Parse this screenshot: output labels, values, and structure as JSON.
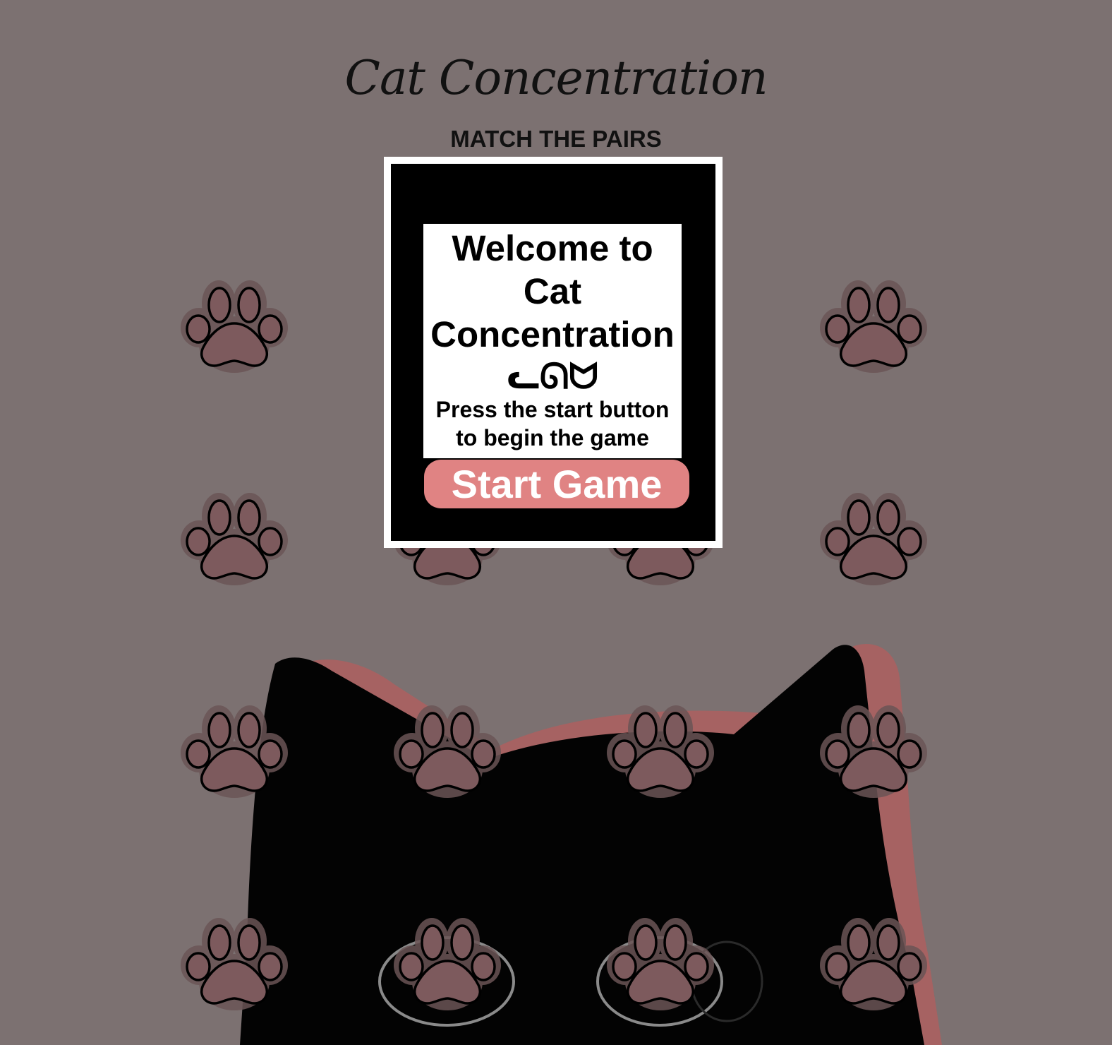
{
  "header": {
    "title": "Cat Concentration",
    "subtitle": "MATCH THE PAIRS"
  },
  "modal": {
    "heading": "Welcome to Cat Concentration",
    "face": "ᓚᘏᗢ",
    "instructions": "Press the start button to begin the game",
    "start_label": "Start Game"
  },
  "board": {
    "rows": 4,
    "columns": 4,
    "card_icon": "paw-icon",
    "cards_face_down": 16
  },
  "colors": {
    "background": "#7c7171",
    "paw_fill": "#7d5a5d",
    "paw_halo": "#6b5556",
    "start_button": "#e08383",
    "cat_silhouette": "#030303",
    "cat_shadow": "#a66262"
  }
}
